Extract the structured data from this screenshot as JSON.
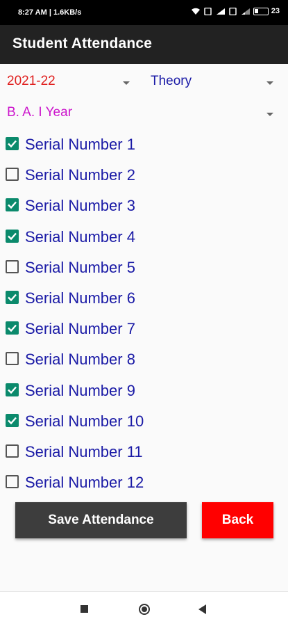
{
  "status_bar": {
    "time": "8:27 AM | 1.6KB/s",
    "battery": "23"
  },
  "app_bar": {
    "title": "Student Attendance"
  },
  "filters": {
    "session": {
      "value": "2021-22",
      "color": "#e0201f"
    },
    "type": {
      "value": "Theory",
      "color": "#1a1aa6"
    },
    "course": {
      "value": "B. A. I Year",
      "color": "#cc16cc"
    }
  },
  "students": [
    {
      "label": "Serial Number 1",
      "checked": true
    },
    {
      "label": "Serial Number 2",
      "checked": false
    },
    {
      "label": "Serial Number 3",
      "checked": true
    },
    {
      "label": "Serial Number 4",
      "checked": true
    },
    {
      "label": "Serial Number 5",
      "checked": false
    },
    {
      "label": "Serial Number 6",
      "checked": true
    },
    {
      "label": "Serial Number 7",
      "checked": true
    },
    {
      "label": "Serial Number 8",
      "checked": false
    },
    {
      "label": "Serial Number 9",
      "checked": true
    },
    {
      "label": "Serial Number 10",
      "checked": true
    },
    {
      "label": "Serial Number 11",
      "checked": false
    },
    {
      "label": "Serial Number 12",
      "checked": false
    }
  ],
  "buttons": {
    "save_label": "Save Attendance",
    "back_label": "Back"
  },
  "colors": {
    "checkbox_checked": "#0b8a6c",
    "label_text": "#1a1aa6",
    "back_button": "#ff0000",
    "save_button": "#3d3d3d"
  },
  "icons": {
    "status": [
      "wifi-icon",
      "sim-icon",
      "signal-icon",
      "battery-icon"
    ],
    "nav": [
      "recents-icon",
      "home-icon",
      "back-icon"
    ]
  }
}
